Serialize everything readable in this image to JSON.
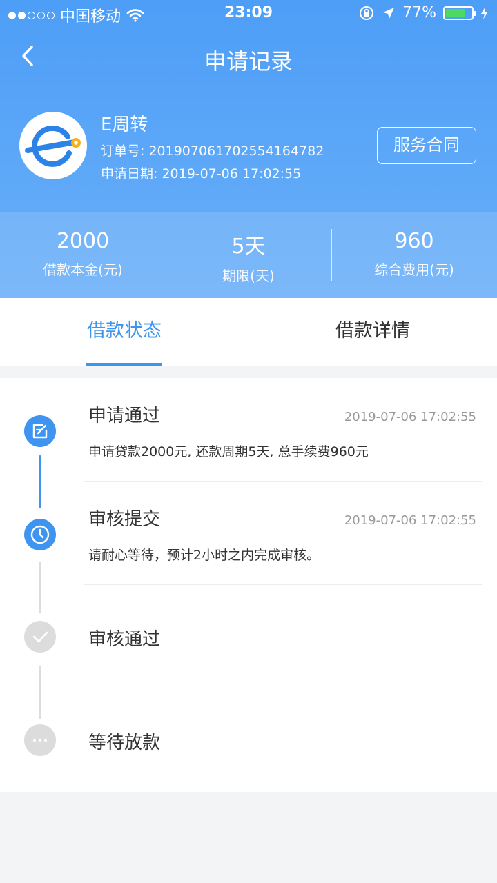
{
  "status_bar": {
    "carrier": "中国移动",
    "time": "23:09",
    "battery": "77%",
    "battery_level": 0.77
  },
  "nav": {
    "title": "申请记录"
  },
  "product": {
    "name": "E周转",
    "order_label": "订单号: 20190706170255416478​2",
    "date_label": "申请日期: 2019-07-06 17:02:55",
    "contract_button": "服务合同"
  },
  "stats": [
    {
      "value": "2000",
      "label": "借款本金(元)"
    },
    {
      "value": "5天",
      "label": "期限(天)"
    },
    {
      "value": "960",
      "label": "综合费用(元)"
    }
  ],
  "tabs": [
    {
      "label": "借款状态",
      "active": true
    },
    {
      "label": "借款详情",
      "active": false
    }
  ],
  "steps": [
    {
      "title": "申请通过",
      "time": "2019-07-06 17:02:55",
      "desc": "申请贷款2000元, 还款周期5天, 总手续费960元",
      "state": "done",
      "icon": "edit-icon"
    },
    {
      "title": "审核提交",
      "time": "2019-07-06 17:02:55",
      "desc": "请耐心等待，预计2小时之内完成审核。",
      "state": "current",
      "icon": "clock-icon"
    },
    {
      "title": "审核通过",
      "time": "",
      "desc": "",
      "state": "pending",
      "icon": "check-icon"
    },
    {
      "title": "等待放款",
      "time": "",
      "desc": "",
      "state": "pending",
      "icon": "more-icon"
    }
  ],
  "colors": {
    "primary": "#3f94ef",
    "header_top": "#4d9ef7",
    "header_bottom": "#6aaff9",
    "pending": "#dcdcdc",
    "battery": "#4cd964"
  }
}
